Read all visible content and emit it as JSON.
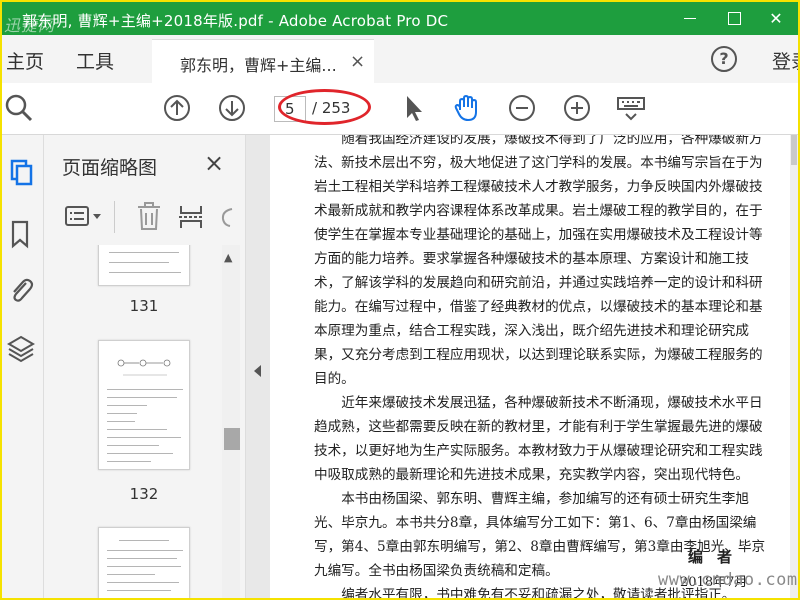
{
  "window": {
    "title": "郭东明, 曹辉+主编+2018年版.pdf - Adobe Acrobat Pro DC",
    "title_bar_color": "#1e9e3e",
    "watermark": "迅捷网"
  },
  "menu": {
    "home": "主页",
    "tools": "工具",
    "doc_tab": "郭东明，曹辉+主编...",
    "doc_tab_close": "×",
    "help": "?",
    "sign_in": "登录"
  },
  "toolbar": {
    "current_page": "5",
    "total_pages": "/ 253",
    "icons": [
      "zoom-search-icon",
      "page-up-icon",
      "page-down-icon",
      "select-cursor-icon",
      "hand-tool-icon",
      "zoom-out-icon",
      "zoom-in-icon",
      "keyboard-icon"
    ],
    "highlight_color": "#e0252b"
  },
  "rail": {
    "icons": [
      "page-thumbnails-icon",
      "bookmark-icon",
      "attachment-icon",
      "layers-icon"
    ]
  },
  "thumbnails": {
    "title": "页面缩略图",
    "close": "×",
    "pages": [
      {
        "label": "131"
      },
      {
        "label": "132"
      }
    ]
  },
  "document": {
    "paragraphs": [
      "随着我国经济建设的发展，爆破技术得到了广泛的应用，各种爆破新方法、新技术层出不穷，极大地促进了这门学科的发展。本书编写宗旨在于为岩土工程相关学科培养工程爆破技术人才教学服务，力争反映国内外爆破技术最新成就和教学内容课程体系改革成果。岩土爆破工程的教学目的，在于使学生在掌握本专业基础理论的基础上，加强在实用爆破技术及工程设计等方面的能力培养。要求掌握各种爆破技术的基本原理、方案设计和施工技术，了解该学科的发展趋向和研究前沿，并通过实践培养一定的设计和科研能力。在编写过程中，借鉴了经典教材的优点，以爆破技术的基本理论和基本原理为重点，结合工程实践，深入浅出，既介绍先进技术和理论研究成果，又充分考虑到工程应用现状，以达到理论联系实际，为爆破工程服务的目的。",
      "近年来爆破技术发展迅猛，各种爆破新技术不断涌现，爆破技术水平日趋成熟，这些都需要反映在新的教材里，才能有利于学生掌握最先进的爆破技术，以更好地为生产实际服务。本教材致力于从爆破理论研究和工程实践中吸取成熟的最新理论和先进技术成果，充实教学内容，突出现代特色。",
      "本书由杨国梁、郭东明、曹辉主编，参加编写的还有硕士研究生李旭光、毕京九。本书共分8章，具体编写分工如下：第1、6、7章由杨国梁编写，第4、5章由郭东明编写，第2、8章由曹辉编写，第3章由李旭光、毕京九编写。全书由杨国梁负责统稿和定稿。",
      "编者水平有限，书中难免有不妥和疏漏之处，敬请读者批评指正。"
    ],
    "signature": "编者",
    "date": "2018年7月"
  },
  "watermark_bottom": "www.cndao.com"
}
